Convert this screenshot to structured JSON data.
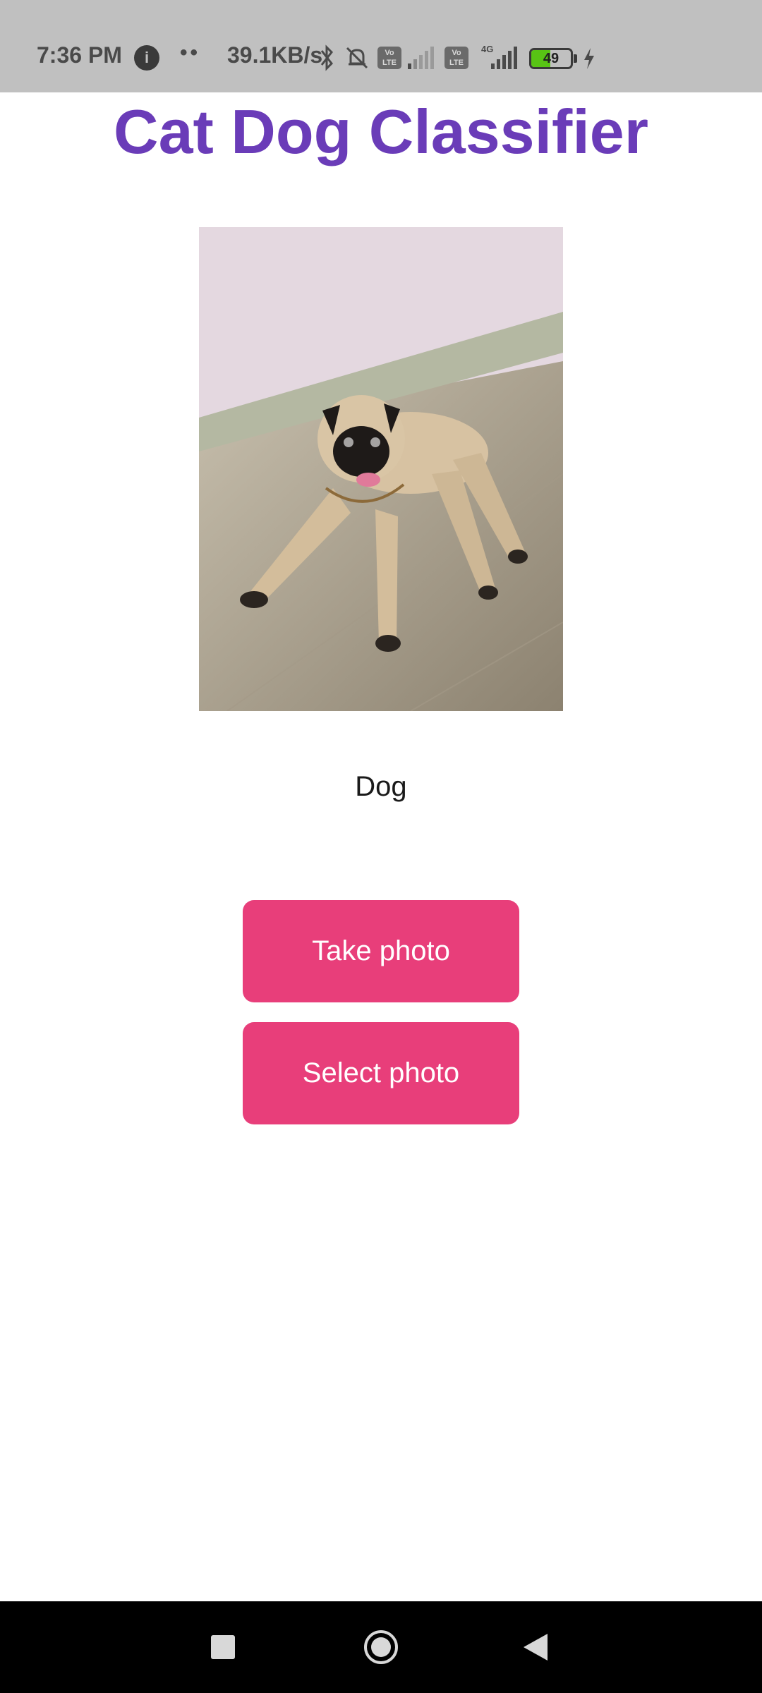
{
  "status_bar": {
    "time": "7:36 PM",
    "app_badge": "i",
    "dots": "••",
    "net_speed": "39.1KB/s",
    "sim1_label_top": "Vo",
    "sim1_label_bottom": "LTE",
    "sim2_label_top": "Vo",
    "sim2_label_bottom": "LTE",
    "sim2_tech": "4G",
    "battery_level": "49",
    "battery_fraction": 0.49,
    "icons": [
      "bluetooth-icon",
      "bell-muted-icon",
      "signal-icon",
      "charging-icon"
    ]
  },
  "app": {
    "title": "Cat Dog Classifier",
    "prediction": "Dog",
    "take_photo_label": "Take photo",
    "select_photo_label": "Select photo"
  },
  "colors": {
    "title": "#6a3cb8",
    "button": "#e83e7a",
    "status_bar": "#c0c0c0"
  },
  "nav_bar": {
    "icons": [
      "recents-square-icon",
      "home-circle-icon",
      "back-triangle-icon"
    ]
  }
}
